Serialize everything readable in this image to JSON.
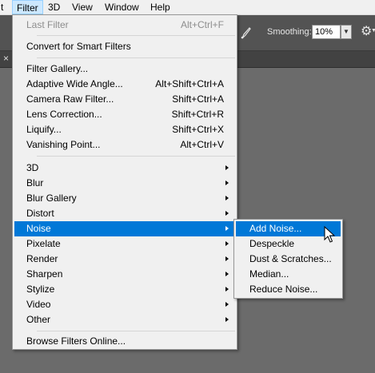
{
  "menubar": {
    "items": [
      "t",
      "Filter",
      "3D",
      "View",
      "Window",
      "Help"
    ]
  },
  "options": {
    "smoothing_label": "Smoothing:",
    "smoothing_value": "10%"
  },
  "tab": {
    "close_glyph": "×"
  },
  "filter_menu": {
    "last_filter": {
      "label": "Last Filter",
      "shortcut": "Alt+Ctrl+F"
    },
    "convert": {
      "label": "Convert for Smart Filters"
    },
    "gallery": {
      "label": "Filter Gallery..."
    },
    "adaptive": {
      "label": "Adaptive Wide Angle...",
      "shortcut": "Alt+Shift+Ctrl+A"
    },
    "camera_raw": {
      "label": "Camera Raw Filter...",
      "shortcut": "Shift+Ctrl+A"
    },
    "lens": {
      "label": "Lens Correction...",
      "shortcut": "Shift+Ctrl+R"
    },
    "liquify": {
      "label": "Liquify...",
      "shortcut": "Shift+Ctrl+X"
    },
    "vanishing": {
      "label": "Vanishing Point...",
      "shortcut": "Alt+Ctrl+V"
    },
    "submenus": [
      "3D",
      "Blur",
      "Blur Gallery",
      "Distort",
      "Noise",
      "Pixelate",
      "Render",
      "Sharpen",
      "Stylize",
      "Video",
      "Other"
    ],
    "browse": {
      "label": "Browse Filters Online..."
    }
  },
  "noise_submenu": {
    "items": [
      "Add Noise...",
      "Despeckle",
      "Dust & Scratches...",
      "Median...",
      "Reduce Noise..."
    ]
  },
  "colors": {
    "highlight": "#0078d7",
    "menu_bg": "#f0f0f0",
    "canvas": "#6b6b6b"
  }
}
